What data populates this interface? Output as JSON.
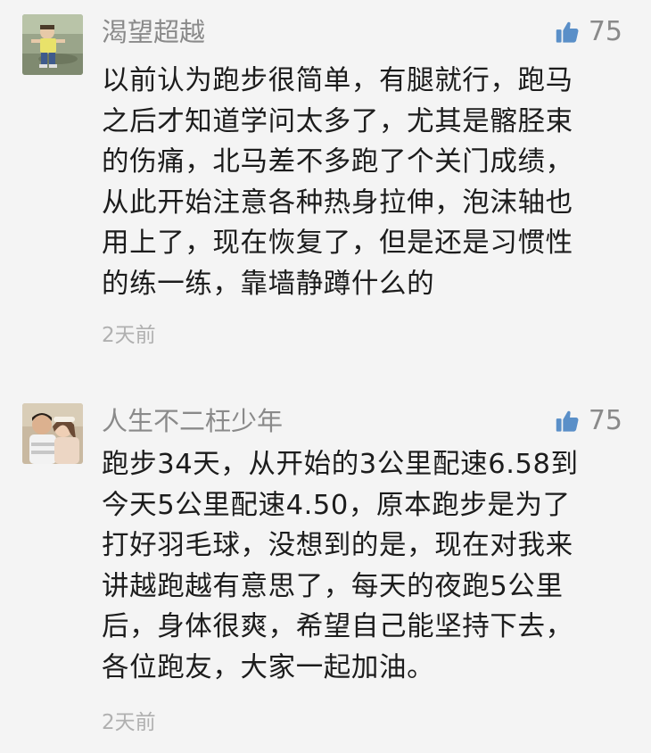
{
  "comments": [
    {
      "nickname": "渴望超越",
      "likes": "75",
      "content": "以前认为跑步很简单，有腿就行，跑马\n之后才知道学问太多了，尤其是髂胫束\n的伤痛，北马差不多跑了个关门成绩，\n从此开始注意各种热身拉伸，泡沫轴也\n用上了，现在恢复了，但是还是习惯性\n的练一练，靠墙静蹲什么的",
      "time": "2天前",
      "avatar_icon": "child-photo-avatar"
    },
    {
      "nickname": "人生不二枉少年",
      "likes": "75",
      "content": "跑步34天，从开始的3公里配速6.58到\n今天5公里配速4.50，原本跑步是为了\n打好羽毛球，没想到的是，现在对我来\n讲越跑越有意思了，每天的夜跑5公里\n后，身体很爽，希望自己能坚持下去，\n各位跑友，大家一起加油。",
      "time": "2天前",
      "avatar_icon": "couple-photo-avatar"
    }
  ],
  "colors": {
    "background": "#f4f4f4",
    "accent_like": "#5a8fc8",
    "secondary_text": "#8a8a8a",
    "time_text": "#b0b0b0"
  }
}
